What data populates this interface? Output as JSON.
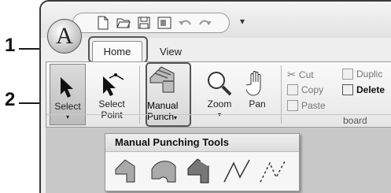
{
  "callouts": [
    "1",
    "2"
  ],
  "app_button": {
    "letter": "A"
  },
  "quick_access": {
    "icons": [
      "new-file-icon",
      "open-folder-icon",
      "save-icon",
      "print-icon",
      "undo-icon",
      "redo-icon"
    ],
    "dropdown": "▾"
  },
  "tabs": {
    "home": "Home",
    "view": "View"
  },
  "ribbon": {
    "select": {
      "line1": "Select",
      "dropdown": "▾"
    },
    "select_point": {
      "line1": "Select",
      "line2": "Point"
    },
    "manual_punch": {
      "line1": "Manual",
      "line2": "Punch",
      "dropdown": "▾"
    },
    "zoom": {
      "line1": "Zoom",
      "dropdown": "▾"
    },
    "pan": {
      "line1": "Pan"
    },
    "clipboard": {
      "cut": "Cut",
      "copy": "Copy",
      "paste": "Paste",
      "duplicate": "Duplic",
      "delete": "Delete",
      "group_label": "board"
    }
  },
  "popup": {
    "title": "Manual Punching Tools",
    "tools": [
      "block-shape-icon",
      "arc-shape-icon",
      "fill-shape-icon",
      "straight-line-icon",
      "dashed-line-icon"
    ]
  },
  "colors": {
    "accent": "#3a3a3a",
    "ribbon_bg": "#eeeeee",
    "canvas": "#c8c8c8"
  }
}
